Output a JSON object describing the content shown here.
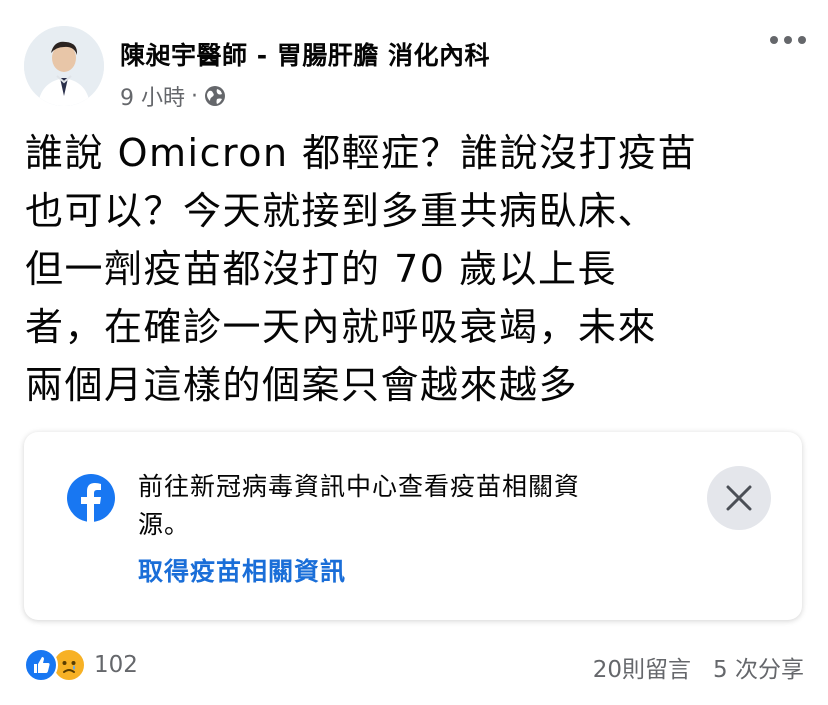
{
  "post": {
    "author": "陳昶宇醫師 - 胃腸肝膽 消化內科",
    "time": "9 小時",
    "separator": "·",
    "privacy_icon": "globe-icon",
    "more_icon": "more-horizontal-icon",
    "text_lines": [
      "誰說 Omicron 都輕症？誰說沒打疫苗",
      "也可以？今天就接到多重共病臥床、",
      "但一劑疫苗都沒打的 70 歲以上長",
      "者，在確診一天內就呼吸衰竭，未來",
      "兩個月這樣的個案只會越來越多"
    ]
  },
  "info_card": {
    "icon": "facebook-icon",
    "text_line1": "前往新冠病毒資訊中心查看疫苗相關資",
    "text_line2": "源。",
    "link_label": "取得疫苗相關資訊",
    "close_icon": "close-icon"
  },
  "footer": {
    "reaction_icons": [
      "like-icon",
      "sad-icon"
    ],
    "reaction_count": "102",
    "comments": "20則留言",
    "shares": "5 次分享"
  },
  "colors": {
    "facebook_blue": "#1877f2",
    "link_blue": "#1a6ed8",
    "secondary_text": "#65676b"
  }
}
